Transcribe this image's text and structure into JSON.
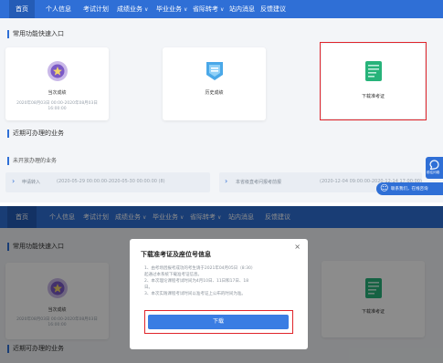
{
  "nav": {
    "items": [
      {
        "label": "首页"
      },
      {
        "label": "个人信息"
      },
      {
        "label": "考试计划"
      },
      {
        "label": "成绩业务",
        "dropdown": true
      },
      {
        "label": "毕业业务",
        "dropdown": true
      },
      {
        "label": "省际转考",
        "dropdown": true
      },
      {
        "label": "站内消息"
      },
      {
        "label": "反馈建议"
      }
    ]
  },
  "sections": {
    "quick_entry": "常用功能快速入口",
    "recent": "近期可办理的业务",
    "not_open": "未开放办理的业务"
  },
  "cards": [
    {
      "label": "当次成绩",
      "time": "2020年08月03日 00:00-2020年08月03日 16:00:00",
      "icon": "medal-icon"
    },
    {
      "label": "历史成绩",
      "time": "",
      "icon": "shield-badge-icon"
    },
    {
      "label": "下载准考证",
      "time": "",
      "icon": "document-icon"
    }
  ],
  "notices": [
    {
      "label": "申请转入",
      "time": "(2020-05-29 00:00:00-2020-05-30 00:00:00 (8)",
      "icon": "arrow-right-icon"
    },
    {
      "label": "本省级直考问报考前报",
      "time": "(2020-12-04 09:00:00-2020-12-14 17:00:00)",
      "icon": "arrow-right-icon"
    }
  ],
  "side_float": {
    "label": "前往问卷",
    "icon": "chat-icon"
  },
  "bottom_float": {
    "label": "联系我们，在线咨询",
    "icon": "smile-icon"
  },
  "modal": {
    "title": "下载准考证及座位号信息",
    "lines": [
      "1、由考场因报考成功的考生请于2021年04月05日（8:30）",
      "起通过本系统下载准考证信息。",
      "2、本次理论课程考试时间为4月10日、11日和17日、18",
      "日。",
      "3、本次实践课程考试时间以准考证上公布的时间为准。"
    ],
    "button_label": "下载",
    "close_symbol": "×"
  },
  "colors": {
    "nav_bg": "#2f6fd6",
    "accent": "#2f6fd6",
    "highlight": "#e0242a",
    "card_bg": "#ffffff",
    "page_bg": "#f3f5f8"
  }
}
